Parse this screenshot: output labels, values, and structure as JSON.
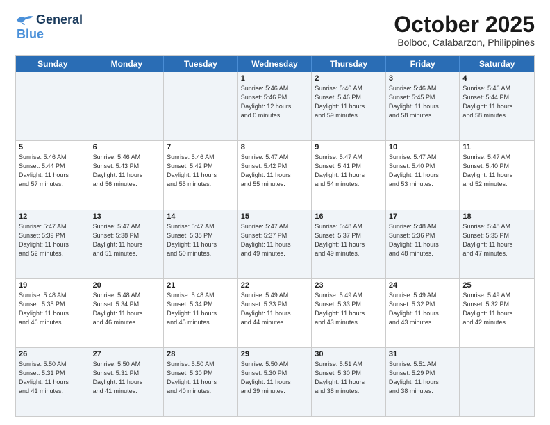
{
  "logo": {
    "line1": "General",
    "line2": "Blue"
  },
  "title": "October 2025",
  "location": "Bolboc, Calabarzon, Philippines",
  "header_days": [
    "Sunday",
    "Monday",
    "Tuesday",
    "Wednesday",
    "Thursday",
    "Friday",
    "Saturday"
  ],
  "rows": [
    [
      {
        "day": "",
        "info": ""
      },
      {
        "day": "",
        "info": ""
      },
      {
        "day": "",
        "info": ""
      },
      {
        "day": "1",
        "info": "Sunrise: 5:46 AM\nSunset: 5:46 PM\nDaylight: 12 hours\nand 0 minutes."
      },
      {
        "day": "2",
        "info": "Sunrise: 5:46 AM\nSunset: 5:46 PM\nDaylight: 11 hours\nand 59 minutes."
      },
      {
        "day": "3",
        "info": "Sunrise: 5:46 AM\nSunset: 5:45 PM\nDaylight: 11 hours\nand 58 minutes."
      },
      {
        "day": "4",
        "info": "Sunrise: 5:46 AM\nSunset: 5:44 PM\nDaylight: 11 hours\nand 58 minutes."
      }
    ],
    [
      {
        "day": "5",
        "info": "Sunrise: 5:46 AM\nSunset: 5:44 PM\nDaylight: 11 hours\nand 57 minutes."
      },
      {
        "day": "6",
        "info": "Sunrise: 5:46 AM\nSunset: 5:43 PM\nDaylight: 11 hours\nand 56 minutes."
      },
      {
        "day": "7",
        "info": "Sunrise: 5:46 AM\nSunset: 5:42 PM\nDaylight: 11 hours\nand 55 minutes."
      },
      {
        "day": "8",
        "info": "Sunrise: 5:47 AM\nSunset: 5:42 PM\nDaylight: 11 hours\nand 55 minutes."
      },
      {
        "day": "9",
        "info": "Sunrise: 5:47 AM\nSunset: 5:41 PM\nDaylight: 11 hours\nand 54 minutes."
      },
      {
        "day": "10",
        "info": "Sunrise: 5:47 AM\nSunset: 5:40 PM\nDaylight: 11 hours\nand 53 minutes."
      },
      {
        "day": "11",
        "info": "Sunrise: 5:47 AM\nSunset: 5:40 PM\nDaylight: 11 hours\nand 52 minutes."
      }
    ],
    [
      {
        "day": "12",
        "info": "Sunrise: 5:47 AM\nSunset: 5:39 PM\nDaylight: 11 hours\nand 52 minutes."
      },
      {
        "day": "13",
        "info": "Sunrise: 5:47 AM\nSunset: 5:38 PM\nDaylight: 11 hours\nand 51 minutes."
      },
      {
        "day": "14",
        "info": "Sunrise: 5:47 AM\nSunset: 5:38 PM\nDaylight: 11 hours\nand 50 minutes."
      },
      {
        "day": "15",
        "info": "Sunrise: 5:47 AM\nSunset: 5:37 PM\nDaylight: 11 hours\nand 49 minutes."
      },
      {
        "day": "16",
        "info": "Sunrise: 5:48 AM\nSunset: 5:37 PM\nDaylight: 11 hours\nand 49 minutes."
      },
      {
        "day": "17",
        "info": "Sunrise: 5:48 AM\nSunset: 5:36 PM\nDaylight: 11 hours\nand 48 minutes."
      },
      {
        "day": "18",
        "info": "Sunrise: 5:48 AM\nSunset: 5:35 PM\nDaylight: 11 hours\nand 47 minutes."
      }
    ],
    [
      {
        "day": "19",
        "info": "Sunrise: 5:48 AM\nSunset: 5:35 PM\nDaylight: 11 hours\nand 46 minutes."
      },
      {
        "day": "20",
        "info": "Sunrise: 5:48 AM\nSunset: 5:34 PM\nDaylight: 11 hours\nand 46 minutes."
      },
      {
        "day": "21",
        "info": "Sunrise: 5:48 AM\nSunset: 5:34 PM\nDaylight: 11 hours\nand 45 minutes."
      },
      {
        "day": "22",
        "info": "Sunrise: 5:49 AM\nSunset: 5:33 PM\nDaylight: 11 hours\nand 44 minutes."
      },
      {
        "day": "23",
        "info": "Sunrise: 5:49 AM\nSunset: 5:33 PM\nDaylight: 11 hours\nand 43 minutes."
      },
      {
        "day": "24",
        "info": "Sunrise: 5:49 AM\nSunset: 5:32 PM\nDaylight: 11 hours\nand 43 minutes."
      },
      {
        "day": "25",
        "info": "Sunrise: 5:49 AM\nSunset: 5:32 PM\nDaylight: 11 hours\nand 42 minutes."
      }
    ],
    [
      {
        "day": "26",
        "info": "Sunrise: 5:50 AM\nSunset: 5:31 PM\nDaylight: 11 hours\nand 41 minutes."
      },
      {
        "day": "27",
        "info": "Sunrise: 5:50 AM\nSunset: 5:31 PM\nDaylight: 11 hours\nand 41 minutes."
      },
      {
        "day": "28",
        "info": "Sunrise: 5:50 AM\nSunset: 5:30 PM\nDaylight: 11 hours\nand 40 minutes."
      },
      {
        "day": "29",
        "info": "Sunrise: 5:50 AM\nSunset: 5:30 PM\nDaylight: 11 hours\nand 39 minutes."
      },
      {
        "day": "30",
        "info": "Sunrise: 5:51 AM\nSunset: 5:30 PM\nDaylight: 11 hours\nand 38 minutes."
      },
      {
        "day": "31",
        "info": "Sunrise: 5:51 AM\nSunset: 5:29 PM\nDaylight: 11 hours\nand 38 minutes."
      },
      {
        "day": "",
        "info": ""
      }
    ]
  ],
  "shaded_rows": [
    0,
    2,
    4
  ],
  "colors": {
    "header_bg": "#2a6db5",
    "header_text": "#ffffff",
    "shaded_cell": "#f0f4f8",
    "empty_cell": "#f9f9f9"
  }
}
